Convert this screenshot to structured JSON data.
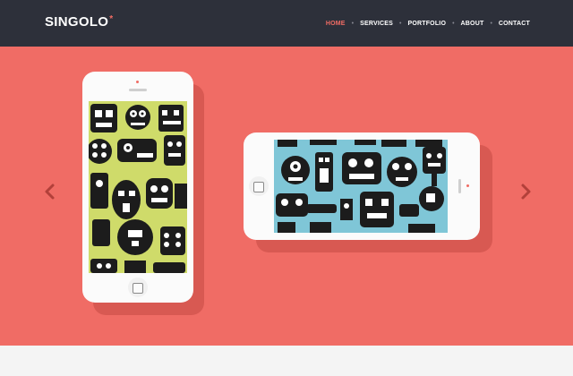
{
  "header": {
    "logo_text": "SINGOLO",
    "logo_mark": "*",
    "nav": [
      {
        "label": "HOME",
        "active": true
      },
      {
        "label": "SERVICES",
        "active": false
      },
      {
        "label": "PORTFOLIO",
        "active": false
      },
      {
        "label": "ABOUT",
        "active": false
      },
      {
        "label": "CONTACT",
        "active": false
      }
    ]
  },
  "slider": {
    "prev_icon": "chevron-left-icon",
    "next_icon": "chevron-right-icon",
    "vertical_phone_wallpaper": "yellow-robot-pattern",
    "horizontal_phone_wallpaper": "blue-robot-pattern"
  },
  "colors": {
    "header_bg": "#2d303a",
    "accent": "#f06c64",
    "hero_bg": "#f06c65",
    "screen_yellow": "#cfdb6a",
    "screen_blue": "#7fc6d7"
  }
}
